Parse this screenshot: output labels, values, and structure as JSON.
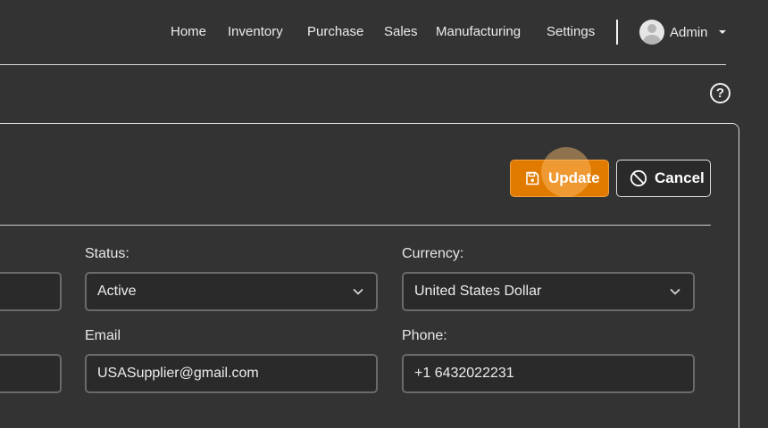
{
  "nav": {
    "items": [
      {
        "label": "Home"
      },
      {
        "label": "Inventory"
      },
      {
        "label": "Purchase"
      },
      {
        "label": "Sales"
      },
      {
        "label": "Manufacturing"
      },
      {
        "label": "Settings"
      }
    ],
    "user": {
      "name": "Admin"
    }
  },
  "help": {
    "symbol": "?"
  },
  "actions": {
    "update_label": "Update",
    "cancel_label": "Cancel"
  },
  "form": {
    "status": {
      "label": "Status:",
      "value": "Active"
    },
    "currency": {
      "label": "Currency:",
      "value": "United States Dollar"
    },
    "email": {
      "label": "Email",
      "value": "USASupplier@gmail.com"
    },
    "phone": {
      "label": "Phone:",
      "value": "+1 6432022231"
    }
  },
  "colors": {
    "background": "#333333",
    "accent": "#e07b00",
    "input_border": "#6a6a6a"
  }
}
